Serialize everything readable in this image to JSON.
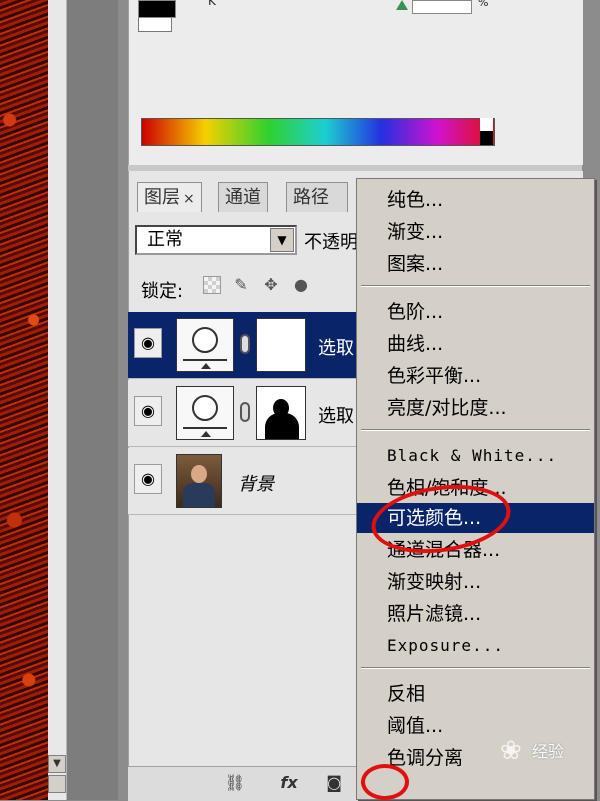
{
  "color_panel": {
    "k_label": "K",
    "percent_label": "%"
  },
  "layers_panel": {
    "tabs": [
      {
        "label": "图层",
        "close": "×"
      },
      {
        "label": "通道"
      },
      {
        "label": "路径"
      }
    ],
    "blend_mode": "正常",
    "opacity_label": "不透明",
    "lock_label": "锁定:",
    "layers": [
      {
        "name": "选取",
        "type": "adjustment",
        "selected": true,
        "mask": "white"
      },
      {
        "name": "选取",
        "type": "adjustment",
        "selected": false,
        "mask": "silhouette"
      },
      {
        "name": "背景",
        "type": "background",
        "selected": false
      }
    ],
    "bottom_icons": [
      "link-icon",
      "fx-icon",
      "mask-icon",
      "adjustment-icon",
      "group-icon",
      "new-layer-icon",
      "trash-icon"
    ],
    "fx_label": "fx"
  },
  "adjustment_menu": {
    "groups": [
      [
        "纯色...",
        "渐变...",
        "图案..."
      ],
      [
        "色阶...",
        "曲线...",
        "色彩平衡...",
        "亮度/对比度..."
      ],
      [
        "Black & White...",
        "色相/饱和度...",
        "可选颜色...",
        "通道混合器...",
        "渐变映射...",
        "照片滤镜...",
        "Exposure..."
      ],
      [
        "反相",
        "阈值...",
        "色调分离"
      ]
    ],
    "highlighted": "可选颜色..."
  },
  "watermark": "经验",
  "colors": {
    "selection": "#0a246a",
    "annotation": "#e01010",
    "menu_bg": "#d4d0c8"
  }
}
